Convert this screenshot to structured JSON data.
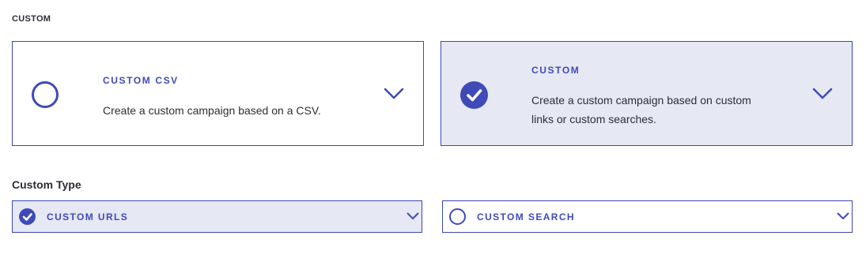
{
  "section": {
    "label": "CUSTOM"
  },
  "cards": [
    {
      "title": "CUSTOM CSV",
      "description": "Create a custom campaign based on a CSV.",
      "selected": false,
      "icon": "radio-empty-icon"
    },
    {
      "title": "CUSTOM",
      "description": "Create a custom campaign based on custom links or custom searches.",
      "selected": true,
      "icon": "check-circle-icon"
    }
  ],
  "custom_type": {
    "label": "Custom Type",
    "options": [
      {
        "label": "CUSTOM URLS",
        "selected": true,
        "icon": "check-circle-icon"
      },
      {
        "label": "CUSTOM SEARCH",
        "selected": false,
        "icon": "radio-empty-icon"
      }
    ]
  },
  "colors": {
    "accent": "#3f4ab8",
    "selected_bg": "#e6e8f3",
    "text": "#2d2d38"
  }
}
